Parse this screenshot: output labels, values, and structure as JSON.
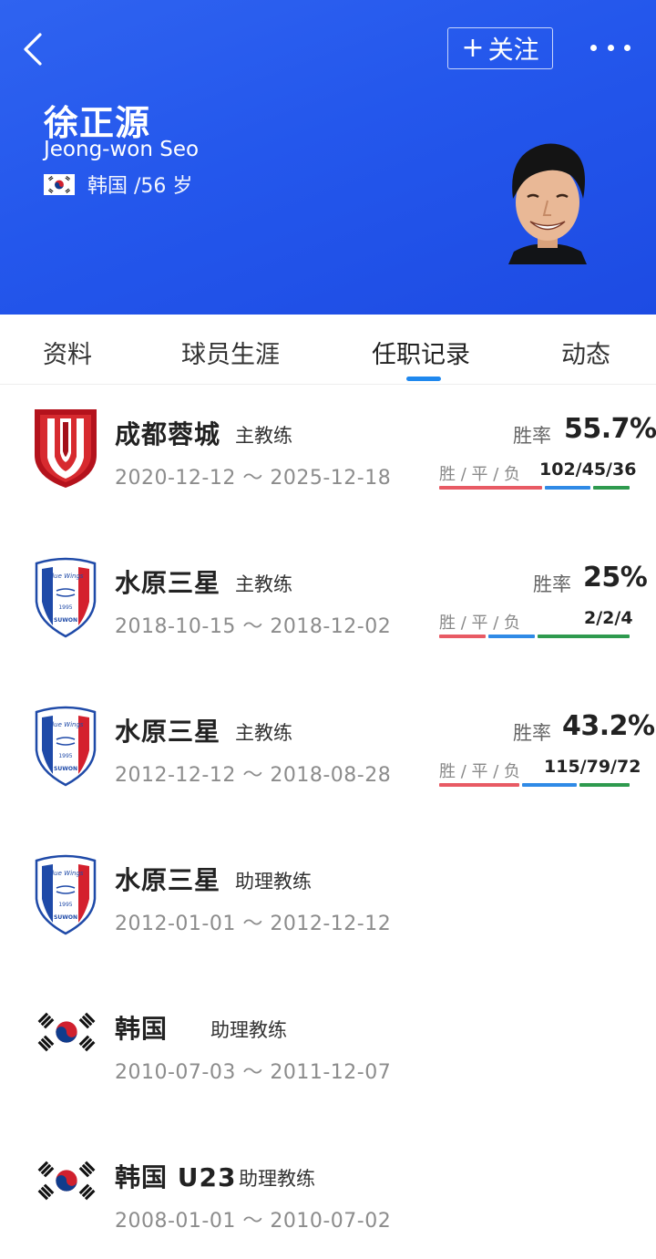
{
  "header": {
    "follow_label": "关注",
    "follow_plus": "+",
    "name_cn": "徐正源",
    "name_en": "Jeong-won Seo",
    "nation_age": "韩国 /56 岁",
    "bg_color": "#2457ec"
  },
  "tabs": [
    {
      "label": "资料",
      "active": false
    },
    {
      "label": "球员生涯",
      "active": false
    },
    {
      "label": "任职记录",
      "active": true
    },
    {
      "label": "动态",
      "active": false
    }
  ],
  "records": [
    {
      "logo": "chengdu-rongcheng-logo",
      "team": "成都蓉城",
      "role": "主教练",
      "dates": "2020-12-12 ～ 2025-12-18",
      "rate_label": "胜率",
      "rate": "55.7%",
      "wdl_label": "胜 / 平 / 负",
      "wdl": "102/45/36",
      "w": 102,
      "d": 45,
      "l": 36
    },
    {
      "logo": "suwon-samsung-logo",
      "team": "水原三星",
      "role": "主教练",
      "dates": "2018-10-15 ～ 2018-12-02",
      "rate_label": "胜率",
      "rate": "25%",
      "wdl_label": "胜 / 平 / 负",
      "wdl": "2/2/4",
      "w": 2,
      "d": 2,
      "l": 4
    },
    {
      "logo": "suwon-samsung-logo",
      "team": "水原三星",
      "role": "主教练",
      "dates": "2012-12-12 ～ 2018-08-28",
      "rate_label": "胜率",
      "rate": "43.2%",
      "wdl_label": "胜 / 平 / 负",
      "wdl": "115/79/72",
      "w": 115,
      "d": 79,
      "l": 72
    },
    {
      "logo": "suwon-samsung-logo",
      "team": "水原三星",
      "role": "助理教练",
      "dates": "2012-01-01 ～ 2012-12-12"
    },
    {
      "logo": "korea-flag",
      "team": "韩国",
      "role": "助理教练",
      "dates": "2010-07-03 ～ 2011-12-07"
    },
    {
      "logo": "korea-flag",
      "team": "韩国 U23",
      "role": "助理教练",
      "dates": "2008-01-01 ～ 2010-07-02"
    }
  ],
  "suwon_badge": {
    "top": "Blue Wings",
    "year": "1995",
    "bottom": "SUWON"
  }
}
